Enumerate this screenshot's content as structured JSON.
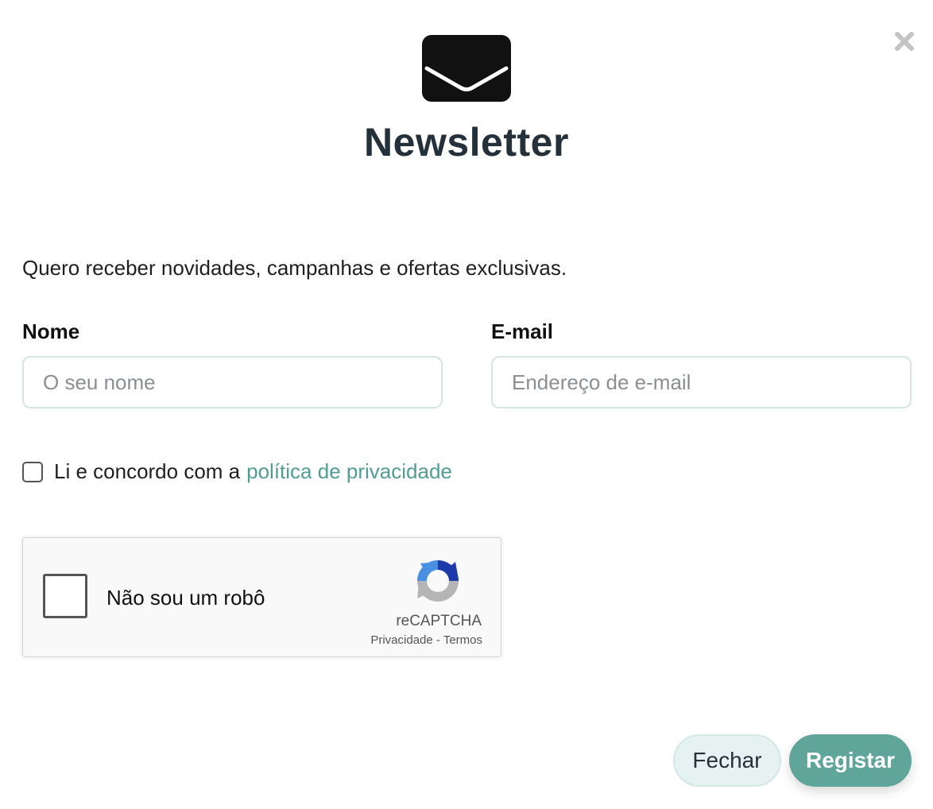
{
  "header": {
    "icon": "envelope-icon",
    "title": "Newsletter",
    "close_icon": "close-icon"
  },
  "intro": "Quero receber novidades, campanhas e ofertas exclusivas.",
  "form": {
    "name": {
      "label": "Nome",
      "placeholder": "O seu nome",
      "value": ""
    },
    "email": {
      "label": "E-mail",
      "placeholder": "Endereço de e-mail",
      "value": ""
    },
    "consent": {
      "text": "Li e concordo com a",
      "link": "política de privacidade",
      "checked": false
    }
  },
  "recaptcha": {
    "label": "Não sou um robô",
    "brand": "reCAPTCHA",
    "privacy": "Privacidade",
    "separator": "-",
    "terms": "Termos"
  },
  "footer": {
    "close_label": "Fechar",
    "submit_label": "Registar"
  },
  "colors": {
    "accent": "#5fa59a",
    "link": "#4f9d93",
    "title": "#24303a",
    "field_border": "#d4e6e4"
  }
}
